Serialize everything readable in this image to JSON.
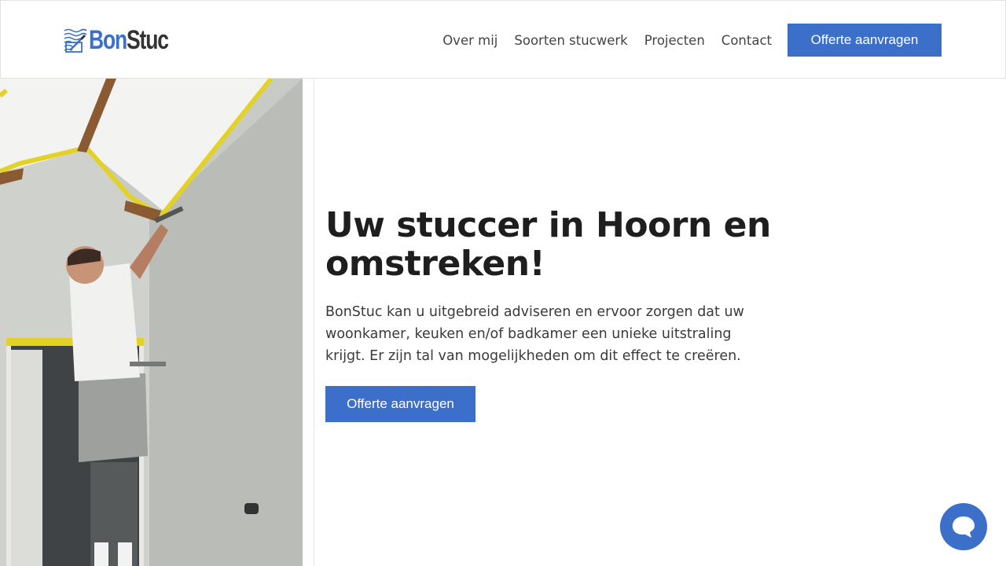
{
  "brand": {
    "name_part1": "Bon",
    "name_part2": "Stuc",
    "accent_color": "#3b6fca"
  },
  "nav": {
    "items": [
      {
        "label": "Over mij"
      },
      {
        "label": "Soorten stucwerk"
      },
      {
        "label": "Projecten"
      },
      {
        "label": "Contact"
      }
    ],
    "cta_label": "Offerte aanvragen"
  },
  "hero": {
    "title": "Uw stuccer in Hoorn en omstreken!",
    "text": "BonStuc kan u uitgebreid adviseren en ervoor zorgen dat uw woonkamer, keuken en/of badkamer een unieke uitstraling krijgt. Er zijn tal van mogelijkheden om dit effect te creëren.",
    "cta_label": "Offerte aanvragen",
    "photo_icon": "plasterer-photo"
  },
  "chat": {
    "icon": "chat-icon"
  }
}
